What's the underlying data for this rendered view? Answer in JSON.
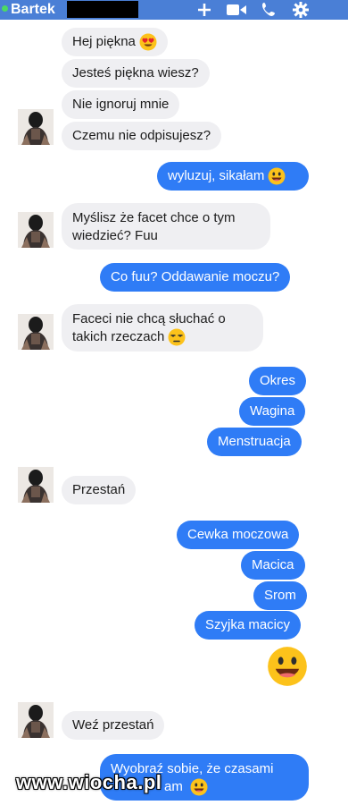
{
  "header": {
    "contact_name": "Bartek",
    "icons": [
      "plus-icon",
      "video-icon",
      "phone-icon",
      "gear-icon"
    ],
    "accent": "#4a7fd6",
    "online_color": "#4cd964"
  },
  "messages": {
    "m1": "Hej piękna",
    "m2": "Jesteś piękna wiesz?",
    "m3": "Nie ignoruj mnie",
    "m4": "Czemu nie odpisujesz?",
    "m5": "wyluzuj, sikałam",
    "m6": "Myślisz że facet chce o tym wiedzieć? Fuu",
    "m7": "Co fuu? Oddawanie moczu?",
    "m8": "Faceci nie chcą słuchać o takich rzeczach",
    "m9": "Okres",
    "m10": "Wagina",
    "m11": "Menstruacja",
    "m12": "Przestań",
    "m13": "Cewka moczowa",
    "m14": "Macica",
    "m15": "Srom",
    "m16": "Szyjka macicy",
    "m17": "Weź przestań",
    "m18": "Wyobraź sobie, że czasami",
    "m18b": "am"
  },
  "emojis": {
    "m1": "heart-eyes-emoji",
    "m5": "grinning-emoji",
    "m8": "unamused-emoji",
    "big": "grinning-emoji",
    "m18": "grinning-emoji"
  },
  "colors": {
    "incoming_bubble": "#efeff2",
    "outgoing_bubble": "#2f7cf6"
  },
  "watermark": "www.wiocha.pl"
}
